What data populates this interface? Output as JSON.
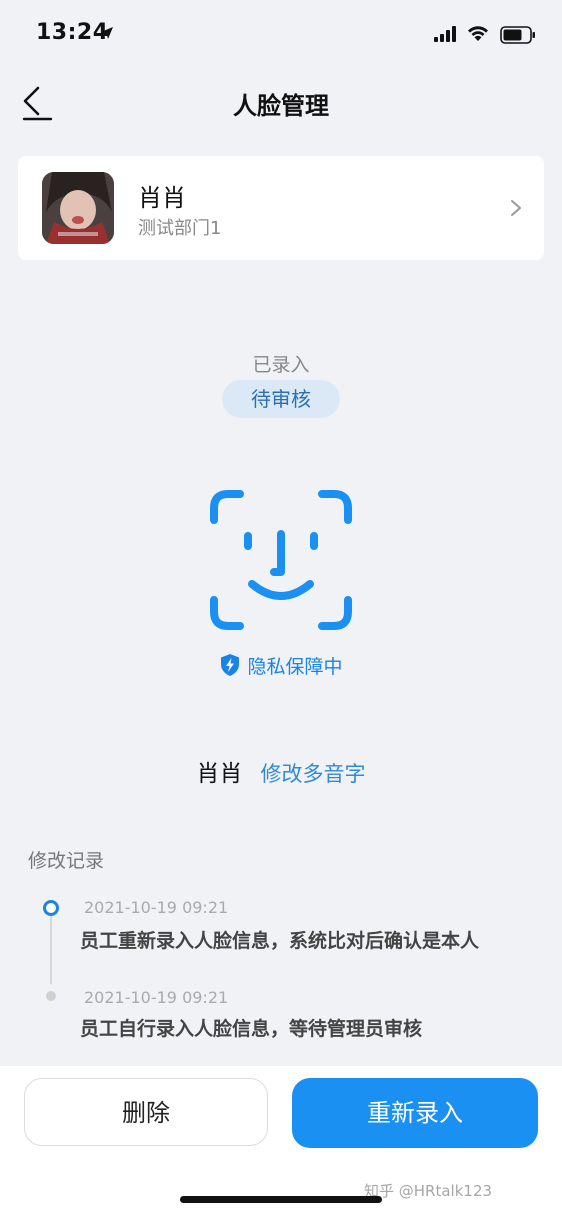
{
  "status_bar": {
    "time": "13:24"
  },
  "nav": {
    "title": "人脸管理"
  },
  "user": {
    "name": "肖肖",
    "department": "测试部门1"
  },
  "enrollment": {
    "recorded_label": "已录入",
    "status_badge": "待审核",
    "privacy_text": "隐私保障中"
  },
  "pronunciation": {
    "name": "肖肖",
    "edit_link": "修改多音字"
  },
  "history": {
    "title": "修改记录",
    "entries": [
      {
        "time": "2021-10-19 09:21",
        "text": "员工重新录入人脸信息，系统比对后确认是本人"
      },
      {
        "time": "2021-10-19 09:21",
        "text": "员工自行录入人脸信息，等待管理员审核"
      }
    ]
  },
  "actions": {
    "delete_label": "删除",
    "re_enroll_label": "重新录入"
  },
  "watermark": "知乎 @HRtalk123",
  "colors": {
    "accent": "#1a90f2",
    "badge_bg": "#dbe9f7",
    "background": "#f1f2f6"
  },
  "icons": [
    "location-arrow-icon",
    "signal-icon",
    "wifi-icon",
    "battery-icon",
    "back-arrow-icon",
    "chevron-right-icon",
    "face-scan-icon",
    "shield-icon"
  ]
}
